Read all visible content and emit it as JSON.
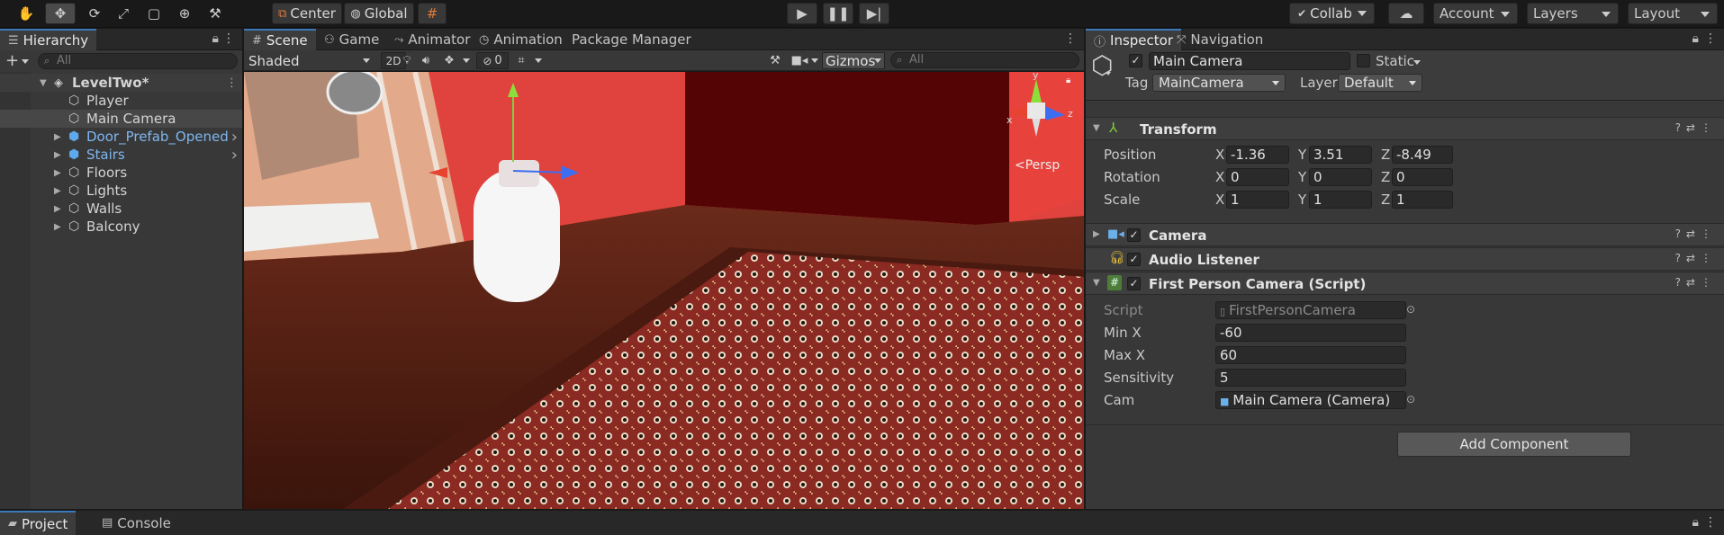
{
  "toolbar": {
    "pivot_label": "Center",
    "space_label": "Global",
    "collab_label": "Collab",
    "account_label": "Account",
    "layers_label": "Layers",
    "layout_label": "Layout"
  },
  "hierarchy": {
    "tab_label": "Hierarchy",
    "search_placeholder": "All",
    "scene_name": "LevelTwo*",
    "items": [
      {
        "name": "Player",
        "prefab": false,
        "expandable": false
      },
      {
        "name": "Main Camera",
        "prefab": false,
        "expandable": false,
        "selected": true
      },
      {
        "name": "Door_Prefab_Opened",
        "prefab": true,
        "expandable": true
      },
      {
        "name": "Stairs",
        "prefab": true,
        "expandable": true
      },
      {
        "name": "Floors",
        "prefab": false,
        "expandable": true
      },
      {
        "name": "Lights",
        "prefab": false,
        "expandable": true
      },
      {
        "name": "Walls",
        "prefab": false,
        "expandable": true
      },
      {
        "name": "Balcony",
        "prefab": false,
        "expandable": true
      }
    ]
  },
  "scene": {
    "tabs": [
      "Scene",
      "Game",
      "Animator",
      "Animation",
      "Package Manager"
    ],
    "shading_mode": "Shaded",
    "mode_2d": "2D",
    "hidden_count": "0",
    "gizmos_label": "Gizmos",
    "search_placeholder": "All",
    "projection_label": "Persp",
    "axis_labels": {
      "x": "x",
      "y": "y",
      "z": "z"
    }
  },
  "inspector": {
    "tabs": [
      "Inspector",
      "Navigation"
    ],
    "object_name": "Main Camera",
    "static_label": "Static",
    "tag_label": "Tag",
    "tag_value": "MainCamera",
    "layer_label": "Layer",
    "layer_value": "Default",
    "transform": {
      "title": "Transform",
      "rows": [
        {
          "label": "Position",
          "x": "-1.36",
          "y": "3.51",
          "z": "-8.49"
        },
        {
          "label": "Rotation",
          "x": "0",
          "y": "0",
          "z": "0"
        },
        {
          "label": "Scale",
          "x": "1",
          "y": "1",
          "z": "1"
        }
      ],
      "axis_x": "X",
      "axis_y": "Y",
      "axis_z": "Z"
    },
    "camera_title": "Camera",
    "audio_title": "Audio Listener",
    "script_component": {
      "title": "First Person Camera (Script)",
      "fields": [
        {
          "label": "Script",
          "value": "FirstPersonCamera"
        },
        {
          "label": "Min X",
          "value": "-60"
        },
        {
          "label": "Max X",
          "value": "60"
        },
        {
          "label": "Sensitivity",
          "value": "5"
        },
        {
          "label": "Cam",
          "value": "Main Camera (Camera)"
        }
      ]
    },
    "add_component_label": "Add Component"
  },
  "bottom": {
    "tabs": [
      "Project",
      "Console"
    ]
  },
  "colors": {
    "accent": "#3a79bb",
    "prefab_text": "#7fb6f0",
    "panel_bg": "#383838"
  }
}
